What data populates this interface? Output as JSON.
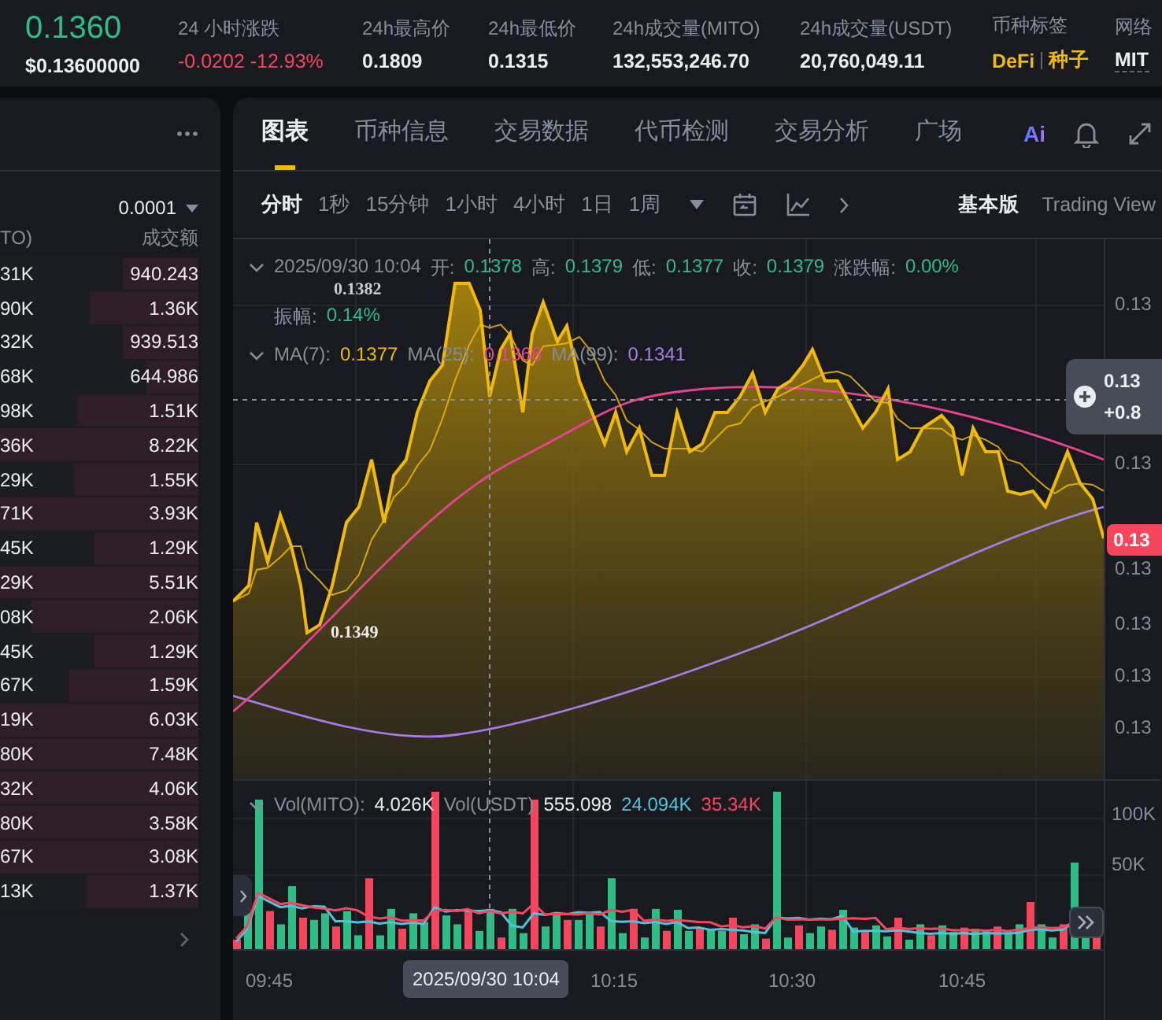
{
  "ticker": {
    "price": "0.1360",
    "usd_price": "$0.13600000"
  },
  "stats": [
    {
      "label": "24 小时涨跌",
      "value": "-0.0202 -12.93%",
      "kind": "down"
    },
    {
      "label": "24h最高价",
      "value": "0.1809",
      "kind": "plain"
    },
    {
      "label": "24h最低价",
      "value": "0.1315",
      "kind": "plain"
    },
    {
      "label": "24h成交量(MITO)",
      "value": "132,553,246.70",
      "kind": "plain"
    },
    {
      "label": "24h成交量(USDT)",
      "value": "20,760,049.11",
      "kind": "plain"
    },
    {
      "label": "币种标签",
      "kind": "tags",
      "tags": [
        "DeFi",
        "种子"
      ]
    },
    {
      "label": "网络",
      "value": "MIT",
      "kind": "network"
    }
  ],
  "order_book": {
    "tick_size": "0.0001",
    "columns": [
      "TO)",
      "成交额"
    ],
    "rows": [
      {
        "amount": "31K",
        "total": "940.243",
        "level": 0.38
      },
      {
        "amount": "90K",
        "total": "1.36K",
        "level": 0.55
      },
      {
        "amount": "32K",
        "total": "939.513",
        "level": 0.38
      },
      {
        "amount": "68K",
        "total": "644.986",
        "level": 0.26
      },
      {
        "amount": "98K",
        "total": "1.51K",
        "level": 0.61
      },
      {
        "amount": "36K",
        "total": "8.22K",
        "level": 1
      },
      {
        "amount": "29K",
        "total": "1.55K",
        "level": 0.63
      },
      {
        "amount": "71K",
        "total": "3.93K",
        "level": 1
      },
      {
        "amount": "45K",
        "total": "1.29K",
        "level": 0.52
      },
      {
        "amount": "29K",
        "total": "5.51K",
        "level": 1
      },
      {
        "amount": "08K",
        "total": "2.06K",
        "level": 0.84
      },
      {
        "amount": "45K",
        "total": "1.29K",
        "level": 0.52
      },
      {
        "amount": "67K",
        "total": "1.59K",
        "level": 0.65
      },
      {
        "amount": "19K",
        "total": "6.03K",
        "level": 1
      },
      {
        "amount": "80K",
        "total": "7.48K",
        "level": 1
      },
      {
        "amount": "32K",
        "total": "4.06K",
        "level": 1
      },
      {
        "amount": "80K",
        "total": "3.58K",
        "level": 1
      },
      {
        "amount": "67K",
        "total": "3.08K",
        "level": 1
      },
      {
        "amount": "13K",
        "total": "1.37K",
        "level": 0.56
      }
    ]
  },
  "chart_panel": {
    "tabs": [
      {
        "label": "图表",
        "selected": true
      },
      {
        "label": "币种信息",
        "selected": false
      },
      {
        "label": "交易数据",
        "selected": false
      },
      {
        "label": "代币检测",
        "selected": false
      },
      {
        "label": "交易分析",
        "selected": false
      },
      {
        "label": "广场",
        "selected": false
      }
    ],
    "ai_button": "Ai",
    "intervals": [
      {
        "label": "分时",
        "selected": true
      },
      {
        "label": "1秒",
        "selected": false
      },
      {
        "label": "15分钟",
        "selected": false
      },
      {
        "label": "1小时",
        "selected": false
      },
      {
        "label": "4小时",
        "selected": false
      },
      {
        "label": "1日",
        "selected": false
      },
      {
        "label": "1周",
        "selected": false
      }
    ],
    "versions": [
      {
        "label": "基本版",
        "selected": true
      },
      {
        "label": "Trading View",
        "selected": false
      }
    ],
    "legend": {
      "time": "2025/09/30 10:04",
      "fields": [
        {
          "label": "开:",
          "value": "0.1378"
        },
        {
          "label": "高:",
          "value": "0.1379"
        },
        {
          "label": "低:",
          "value": "0.1377"
        },
        {
          "label": "收:",
          "value": "0.1379"
        },
        {
          "label": "涨跌幅:",
          "value": "0.00%"
        },
        {
          "label": "振幅:",
          "value": "0.14%"
        }
      ]
    },
    "moving_averages": [
      {
        "label": "MA(7):",
        "value": "0.1377",
        "color": "#f0b90b"
      },
      {
        "label": "MA(25):",
        "value": "0.1368",
        "color": "#e84393"
      },
      {
        "label": "MA(99):",
        "value": "0.1341",
        "color": "#a67ce6"
      }
    ],
    "high_marker": "0.1382",
    "low_marker": "0.1349",
    "price_axis": [
      "0.13",
      "0.13",
      "0.13",
      "0.13",
      "0.13",
      "0.13"
    ],
    "crosshair_tag": {
      "price": "0.13",
      "change": "+0.8"
    },
    "last_price_tag": "0.13",
    "volume_legend": [
      {
        "label": "Vol(MITO):",
        "value": "4.026K",
        "color": "#eaecef"
      },
      {
        "label": "Vol(USDT)",
        "value": "555.098",
        "color": "#eaecef"
      },
      {
        "value": "24.094K",
        "color": "#4fc3dc"
      },
      {
        "value": "35.34K",
        "color": "#f6465d"
      }
    ],
    "volume_axis": [
      "100K",
      "50K"
    ],
    "time_axis": [
      {
        "label": "09:45",
        "kind": "tick"
      },
      {
        "label": "2025/09/30 10:04",
        "kind": "crosshair"
      },
      {
        "label": "10:15",
        "kind": "tick"
      },
      {
        "label": "10:30",
        "kind": "tick"
      },
      {
        "label": "10:45",
        "kind": "tick"
      }
    ]
  }
}
